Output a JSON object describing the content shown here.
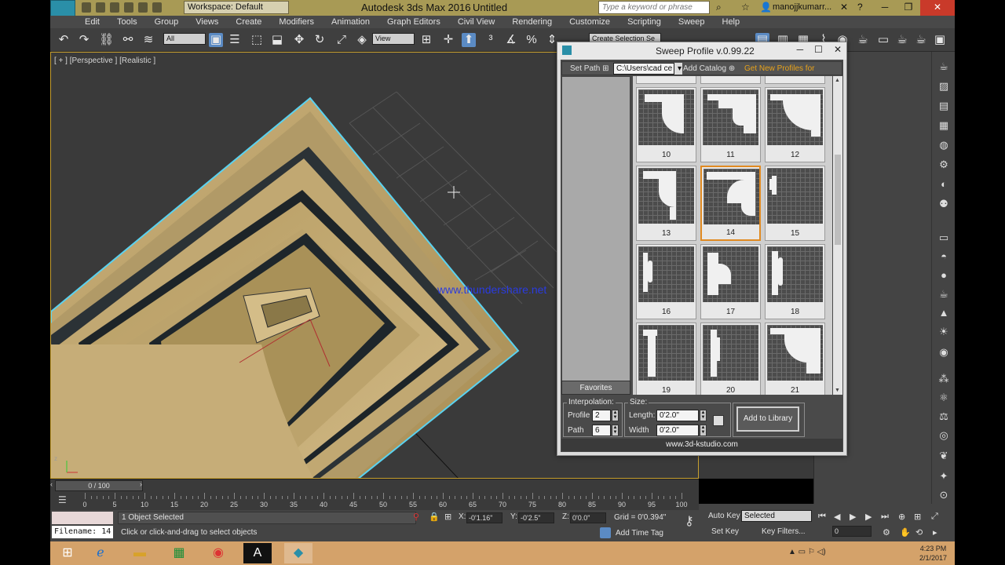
{
  "titlebar": {
    "logo_text": "MAX",
    "workspace": "Workspace: Default",
    "app_title": "Autodesk 3ds Max 2016",
    "doc_name": "Untitled",
    "search_placeholder": "Type a keyword or phrase",
    "username": "manojjkumarr...",
    "min_btn": "─",
    "max_btn": "❐",
    "close_btn": "✕"
  },
  "menu": [
    "Edit",
    "Tools",
    "Group",
    "Views",
    "Create",
    "Modifiers",
    "Animation",
    "Graph Editors",
    "Civil View",
    "Rendering",
    "Customize",
    "Scripting",
    "Sweep",
    "Help"
  ],
  "toolbar": {
    "filter_select": "All",
    "view_select": "View",
    "selection_set": "Create Selection Se"
  },
  "viewport": {
    "label": "[ + ] [Perspective ] [Realistic ]",
    "watermark": "www.thundershare.net"
  },
  "dialog": {
    "title": "Sweep Profile v.0.99.22",
    "set_path": "Set Path",
    "path_value": "C:\\Users\\cad ce",
    "add_catalog": "Add Catalog",
    "get_new": "Get New Profiles for Sweep",
    "favorites": "Favorites",
    "selected_tile": "14",
    "tiles": [
      "10",
      "11",
      "12",
      "13",
      "14",
      "15",
      "16",
      "17",
      "18",
      "19",
      "20",
      "21"
    ],
    "interpolation": {
      "title": "Interpolation:",
      "profile_label": "Profile",
      "profile_value": "2",
      "path_label": "Path",
      "path_value": "6"
    },
    "size": {
      "title": "Size:",
      "length_label": "Length:",
      "length_value": "0'2.0\"",
      "width_label": "Width",
      "width_value": "0'2.0\""
    },
    "add_to_library": "Add to Library",
    "website": "www.3d-kstudio.com"
  },
  "timeline": {
    "slider_label": "0 / 100",
    "ticks": [
      "0",
      "5",
      "10",
      "15",
      "20",
      "25",
      "30",
      "35",
      "40",
      "45",
      "50",
      "55",
      "60",
      "65",
      "70",
      "75",
      "80",
      "85",
      "90",
      "95",
      "100"
    ]
  },
  "status": {
    "filename": "Filename: 14",
    "selected": "1 Object Selected",
    "prompt": "Click or click-and-drag to select objects",
    "x_label": "X:",
    "x_value": "-0'1.16\"",
    "y_label": "Y:",
    "y_value": "-0'2.5\"",
    "z_label": "Z:",
    "z_value": "0'0.0\"",
    "grid": "Grid = 0'0.394\"",
    "add_time_tag": "Add Time Tag"
  },
  "anim": {
    "auto_key": "Auto Key",
    "set_key": "Set Key",
    "selected": "Selected",
    "key_filters": "Key Filters...",
    "frame": "0"
  },
  "taskbar": {
    "time": "4:23 PM",
    "date": "2/1/2017"
  }
}
